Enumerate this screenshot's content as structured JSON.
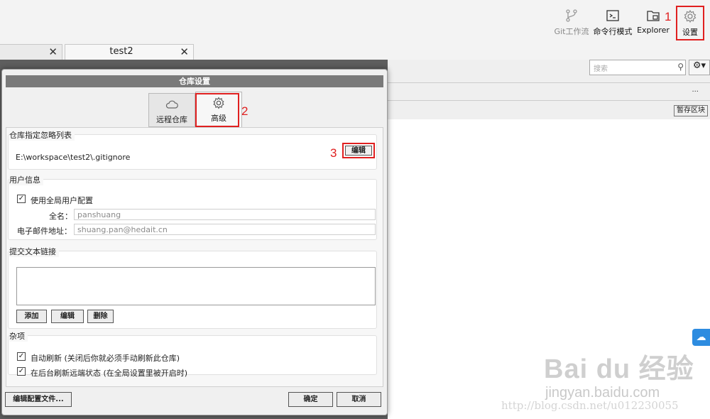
{
  "toolbar": {
    "git_flow": "Git工作流",
    "terminal": "命令行模式",
    "explorer": "Explorer",
    "settings": "设置"
  },
  "annotations": {
    "a1": "1",
    "a2": "2",
    "a3": "3"
  },
  "tabs": [
    {
      "label": ""
    },
    {
      "label": "test2"
    }
  ],
  "background": {
    "search_placeholder": "搜索",
    "ellipsis": "...",
    "stash_label": "暂存区块"
  },
  "dialog": {
    "title": "仓库设置",
    "tabs": {
      "remote": "远程仓库",
      "advanced": "高级"
    },
    "ignore": {
      "title": "仓库指定忽略列表",
      "path": "E:\\workspace\\test2\\.gitignore",
      "edit": "编辑"
    },
    "user": {
      "title": "用户信息",
      "use_global": "使用全局用户配置",
      "fullname_label": "全名：",
      "fullname_value": "panshuang",
      "email_label": "电子邮件地址：",
      "email_value": "shuang.pan@hedait.cn"
    },
    "links": {
      "title": "提交文本链接",
      "add": "添加",
      "edit": "编辑",
      "delete": "删除"
    },
    "misc": {
      "title": "杂项",
      "auto_refresh": "自动刷新 (关闭后你就必须手动刷新此仓库)",
      "bg_refresh": "在后台刷新远端状态 (在全局设置里被开启时)"
    },
    "footer": {
      "edit_config": "编辑配置文件...",
      "ok": "确定",
      "cancel": "取消"
    }
  },
  "watermark": {
    "logo": "Bai du 经验",
    "site": "jingyan.baidu.com",
    "url": "http://blog.csdn.net/u012230055"
  },
  "colors": {
    "highlight": "#e02020",
    "title_bar": "#7a7a7a",
    "side_button": "#2d8ce0"
  }
}
